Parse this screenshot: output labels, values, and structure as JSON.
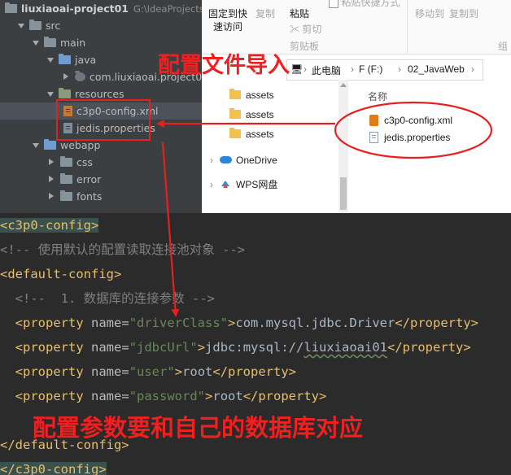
{
  "ide": {
    "project_name": "liuxiaoai-project01",
    "project_path": "G:\\IdeaProjectsd\\",
    "tree": [
      {
        "label": "src"
      },
      {
        "label": "main"
      },
      {
        "label": "java"
      },
      {
        "label": "com.liuxiaoai.project01"
      },
      {
        "label": "resources"
      },
      {
        "label": "c3p0-config.xml"
      },
      {
        "label": "jedis.properties"
      },
      {
        "label": "webapp"
      },
      {
        "label": "css"
      },
      {
        "label": "error"
      },
      {
        "label": "fonts"
      }
    ]
  },
  "explorer": {
    "ribbon": {
      "pin_quick_access_line1": "固定到快",
      "pin_quick_access_line2": "速访问",
      "copy": "复制",
      "paste": "粘贴",
      "cut": "剪切",
      "clipboard_group": "剪贴板",
      "paste_shortcut": "粘贴快捷方式",
      "move_to": "移动到",
      "copy_to": "复制到",
      "organize_partial": "组"
    },
    "address": {
      "this_pc": "此电脑",
      "drive": "F (F:)",
      "folder": "02_JavaWeb"
    },
    "nav": [
      {
        "label": "assets"
      },
      {
        "label": "assets"
      },
      {
        "label": "assets"
      },
      {
        "label": "OneDrive"
      },
      {
        "label": "WPS网盘"
      }
    ],
    "content": {
      "column_name": "名称",
      "files": [
        {
          "label": "c3p0-config.xml"
        },
        {
          "label": "jedis.properties"
        }
      ]
    }
  },
  "editor": {
    "lines": {
      "l1_tag": "<c3p0-config>",
      "l2_comment": "<!-- 使用默认的配置读取连接池对象 -->",
      "l3_tag": "<default-config>",
      "l4_comment": "<!--  1. 数据库的连接参数 -->",
      "property_open": "<property",
      "property_close": "</property>",
      "name_attr": "name=",
      "tag_end": ">",
      "p1_name": "\"driverClass\"",
      "p1_value": "com.mysql.jdbc.Driver",
      "p2_name": "\"jdbcUrl\"",
      "p2_value_prefix": "jdbc:mysql://",
      "p2_value_db": "liuxiaoai01",
      "p3_name": "\"user\"",
      "p3_value": "root",
      "p4_name": "\"password\"",
      "p4_value": "root",
      "l10_tag": "</default-config>",
      "l11_tag": "</c3p0-config>"
    }
  },
  "annotations": {
    "import_config": "配置文件导入",
    "match_database": "配置参数要和自己的数据库对应"
  },
  "colors": {
    "annotation_red": "#ee2020",
    "ide_bg": "#3c3f41",
    "editor_bg": "#2b2b2b",
    "xml_tag": "#e8bf6a",
    "xml_value": "#6a8759",
    "xml_comment": "#808080"
  }
}
